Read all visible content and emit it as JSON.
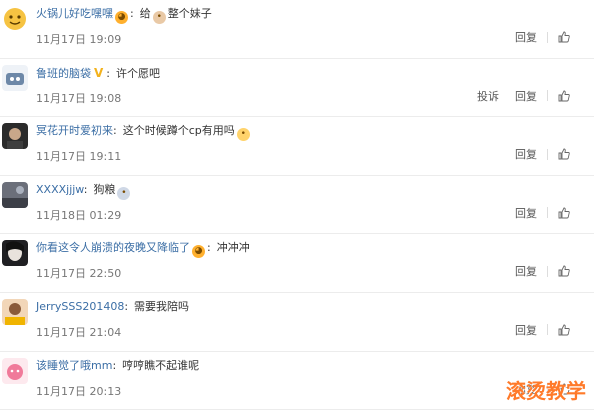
{
  "comments": [
    {
      "username": "火锅儿好吃嘿嘿",
      "text": "给",
      "text2": "整个妹子",
      "time": "11月17日 19:09",
      "report": "",
      "reply": "回复"
    },
    {
      "username": "鲁班的脑袋",
      "text": "许个愿吧",
      "text2": "",
      "time": "11月17日 19:08",
      "report": "投诉",
      "reply": "回复"
    },
    {
      "username": "冥花开时爱初来",
      "text": "这个时候蹲个cp有用吗",
      "text2": "",
      "time": "11月17日 19:11",
      "report": "",
      "reply": "回复"
    },
    {
      "username": "XXXXjjjw",
      "text": "狗粮",
      "text2": "",
      "time": "11月18日 01:29",
      "report": "",
      "reply": "回复"
    },
    {
      "username": "你看这令人崩溃的夜晚又降临了",
      "text": "冲冲冲",
      "text2": "",
      "time": "11月17日 22:50",
      "report": "",
      "reply": "回复"
    },
    {
      "username": "JerrySSS201408",
      "text": "需要我陪吗",
      "text2": "",
      "time": "11月17日 21:04",
      "report": "",
      "reply": "回复"
    },
    {
      "username": "该睡觉了哦mm",
      "text": "哼哼瞧不起谁呢",
      "text2": "",
      "time": "11月17日 20:13",
      "report": "",
      "reply": "回复"
    }
  ],
  "watermark": "滚烫教学",
  "colors": {
    "username": "#3b6ea5",
    "watermark": "#ff7a2a"
  }
}
